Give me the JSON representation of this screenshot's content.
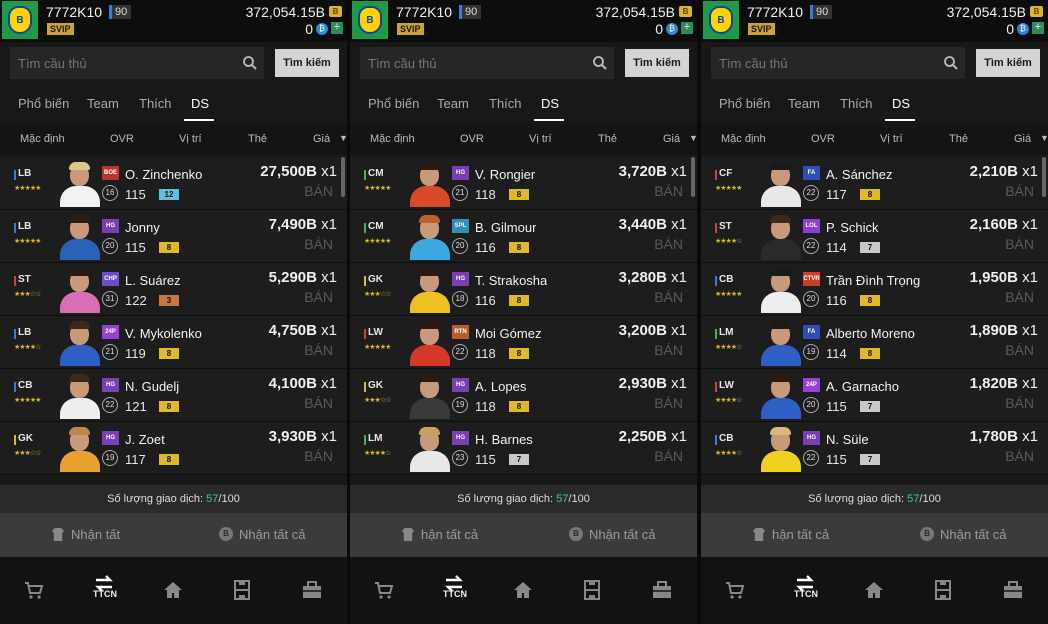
{
  "panels": [
    {
      "user": {
        "name": "7772K10",
        "level": "90",
        "svip": "SVIP",
        "coins": "372,054.15B",
        "credits": "0"
      },
      "search": {
        "placeholder": "Tìm cầu thủ",
        "button": "Tìm kiếm"
      },
      "tabs": [
        "Phổ biến",
        "Team",
        "Thích",
        "DS"
      ],
      "active_tab": "DS",
      "columns": [
        "Mặc định",
        "OVR",
        "Vị trí",
        "Thẻ",
        "Giá"
      ],
      "rows": [
        {
          "pos": "LB",
          "pos_color": "#3c7bd8",
          "stars": "★★★★★",
          "season": "BOE",
          "season_color": "#b8372c",
          "name": "O. Zinchenko",
          "ovr": "115",
          "level": "16",
          "grade": "12",
          "grade_color": "#5ec0e6",
          "price": "27,500B",
          "qty": "x1",
          "sell": "BÁN",
          "hair": "#d9c88c",
          "shirt": "#f2f2f2"
        },
        {
          "pos": "LB",
          "pos_color": "#3c7bd8",
          "stars": "★★★★★",
          "season": "HG",
          "season_color": "#7a3fb5",
          "name": "Jonny",
          "ovr": "115",
          "level": "20",
          "grade": "8",
          "grade_color": "#e0b92a",
          "price": "7,490B",
          "qty": "x1",
          "sell": "BÁN",
          "hair": "#2b1d14",
          "shirt": "#2b62b8"
        },
        {
          "pos": "ST",
          "pos_color": "#d04040",
          "stars": "★★★☆☆",
          "season": "CHP",
          "season_color": "#6a4fc9",
          "name": "L. Suárez",
          "ovr": "122",
          "level": "31",
          "grade": "3",
          "grade_color": "#c7773f",
          "price": "5,290B",
          "qty": "x1",
          "sell": "BÁN",
          "hair": "#2a1a12",
          "shirt": "#d86fb5"
        },
        {
          "pos": "LB",
          "pos_color": "#3c7bd8",
          "stars": "★★★★☆",
          "season": "24P",
          "season_color": "#9a3fd6",
          "name": "V. Mykolenko",
          "ovr": "119",
          "level": "21",
          "grade": "8",
          "grade_color": "#e0b92a",
          "price": "4,750B",
          "qty": "x1",
          "sell": "BÁN",
          "hair": "#3a2a1c",
          "shirt": "#2d5fc4"
        },
        {
          "pos": "CB",
          "pos_color": "#3c7bd8",
          "stars": "★★★★★",
          "season": "HG",
          "season_color": "#7a3fb5",
          "name": "N. Gudelj",
          "ovr": "121",
          "level": "22",
          "grade": "8",
          "grade_color": "#e0b92a",
          "price": "4,100B",
          "qty": "x1",
          "sell": "BÁN",
          "hair": "#3a2a1c",
          "shirt": "#eeeeee"
        },
        {
          "pos": "GK",
          "pos_color": "#e0b92a",
          "stars": "★★★☆☆",
          "season": "HG",
          "season_color": "#7a3fb5",
          "name": "J. Zoet",
          "ovr": "117",
          "level": "19",
          "grade": "8",
          "grade_color": "#e0b92a",
          "price": "3,930B",
          "qty": "x1",
          "sell": "BÁN",
          "hair": "#b98a4a",
          "shirt": "#e8a030"
        }
      ],
      "trades": {
        "label": "Số lượng giao dịch:",
        "count": "57",
        "total": "/100"
      },
      "actions": {
        "receive_all": "Nhận tất",
        "receive_all_coins": "Nhận tất cả"
      },
      "nav": {
        "market_label": "TTCN"
      }
    },
    {
      "user": {
        "name": "7772K10",
        "level": "90",
        "svip": "SVIP",
        "coins": "372,054.15B",
        "credits": "0"
      },
      "search": {
        "placeholder": "Tìm cầu thủ",
        "button": "Tìm kiếm"
      },
      "tabs": [
        "Phổ biến",
        "Team",
        "Thích",
        "DS"
      ],
      "active_tab": "DS",
      "columns": [
        "Mặc định",
        "OVR",
        "Vị trí",
        "Thẻ",
        "Giá"
      ],
      "rows": [
        {
          "pos": "CM",
          "pos_color": "#3fb55a",
          "stars": "★★★★★",
          "season": "HG",
          "season_color": "#7a3fb5",
          "name": "V. Rongier",
          "ovr": "118",
          "level": "21",
          "grade": "8",
          "grade_color": "#e0b92a",
          "price": "3,720B",
          "qty": "x1",
          "sell": "BÁN",
          "hair": "#2a1a12",
          "shirt": "#d84a2a"
        },
        {
          "pos": "CM",
          "pos_color": "#3fb55a",
          "stars": "★★★★★",
          "season": "SPL",
          "season_color": "#2f8fb5",
          "name": "B. Gilmour",
          "ovr": "116",
          "level": "20",
          "grade": "8",
          "grade_color": "#e0b92a",
          "price": "3,440B",
          "qty": "x1",
          "sell": "BÁN",
          "hair": "#b9622a",
          "shirt": "#3ea6e0"
        },
        {
          "pos": "GK",
          "pos_color": "#e0b92a",
          "stars": "★★★☆☆",
          "season": "HG",
          "season_color": "#7a3fb5",
          "name": "T. Strakosha",
          "ovr": "116",
          "level": "18",
          "grade": "8",
          "grade_color": "#e0b92a",
          "price": "3,280B",
          "qty": "x1",
          "sell": "BÁN",
          "hair": "#2a1a12",
          "shirt": "#f0c020"
        },
        {
          "pos": "LW",
          "pos_color": "#d04040",
          "stars": "★★★★★",
          "season": "RTN",
          "season_color": "#b8602c",
          "name": "Moi Gómez",
          "ovr": "118",
          "level": "22",
          "grade": "8",
          "grade_color": "#e0b92a",
          "price": "3,200B",
          "qty": "x1",
          "sell": "BÁN",
          "hair": "#2a1a12",
          "shirt": "#d8382a"
        },
        {
          "pos": "GK",
          "pos_color": "#e0b92a",
          "stars": "★★★☆☆",
          "season": "HG",
          "season_color": "#7a3fb5",
          "name": "A. Lopes",
          "ovr": "118",
          "level": "19",
          "grade": "8",
          "grade_color": "#e0b92a",
          "price": "2,930B",
          "qty": "x1",
          "sell": "BÁN",
          "hair": "#2a1a12",
          "shirt": "#3a3a3a"
        },
        {
          "pos": "LM",
          "pos_color": "#3fb55a",
          "stars": "★★★★☆",
          "season": "HG",
          "season_color": "#7a3fb5",
          "name": "H. Barnes",
          "ovr": "115",
          "level": "23",
          "grade": "7",
          "grade_color": "#c8c8c8",
          "price": "2,250B",
          "qty": "x1",
          "sell": "BÁN",
          "hair": "#c9a060",
          "shirt": "#e8e8e8"
        }
      ],
      "trades": {
        "label": "Số lượng giao dịch:",
        "count": "57",
        "total": "/100"
      },
      "actions": {
        "receive_all": "hận tất cả",
        "receive_all_coins": "Nhận tất cả"
      },
      "nav": {
        "market_label": "TTCN"
      }
    },
    {
      "user": {
        "name": "7772K10",
        "level": "90",
        "svip": "SVIP",
        "coins": "372,054.15B",
        "credits": "0"
      },
      "search": {
        "placeholder": "Tìm cầu thủ",
        "button": "Tìm kiếm"
      },
      "tabs": [
        "Phổ biến",
        "Team",
        "Thích",
        "DS"
      ],
      "active_tab": "DS",
      "columns": [
        "Mặc định",
        "OVR",
        "Vị trí",
        "Thẻ",
        "Giá"
      ],
      "rows": [
        {
          "pos": "CF",
          "pos_color": "#d04040",
          "stars": "★★★★★",
          "season": "FA",
          "season_color": "#2f4fb5",
          "name": "A. Sánchez",
          "ovr": "117",
          "level": "22",
          "grade": "8",
          "grade_color": "#e0b92a",
          "price": "2,210B",
          "qty": "x1",
          "sell": "BÁN",
          "hair": "#1a1a1a",
          "shirt": "#e8e8e8"
        },
        {
          "pos": "ST",
          "pos_color": "#d04040",
          "stars": "★★★★☆",
          "season": "LOL",
          "season_color": "#8f3fd6",
          "name": "P. Schick",
          "ovr": "114",
          "level": "22",
          "grade": "7",
          "grade_color": "#c8c8c8",
          "price": "2,160B",
          "qty": "x1",
          "sell": "BÁN",
          "hair": "#3a2a1c",
          "shirt": "#2a2a2a"
        },
        {
          "pos": "CB",
          "pos_color": "#3c7bd8",
          "stars": "★★★★★",
          "season": "CTVR",
          "season_color": "#c8402a",
          "name": "Trần Đình Trọng",
          "ovr": "116",
          "level": "20",
          "grade": "8",
          "grade_color": "#e0b92a",
          "price": "1,950B",
          "qty": "x1",
          "sell": "BÁN",
          "hair": "#1a1a1a",
          "shirt": "#eeeeee"
        },
        {
          "pos": "LM",
          "pos_color": "#3fb55a",
          "stars": "★★★★☆",
          "season": "FA",
          "season_color": "#2f4fb5",
          "name": "Alberto Moreno",
          "ovr": "114",
          "level": "19",
          "grade": "8",
          "grade_color": "#e0b92a",
          "price": "1,890B",
          "qty": "x1",
          "sell": "BÁN",
          "hair": "#1a1a1a",
          "shirt": "#2d5fc4"
        },
        {
          "pos": "LW",
          "pos_color": "#d04040",
          "stars": "★★★★☆",
          "season": "24P",
          "season_color": "#9a3fd6",
          "name": "A. Garnacho",
          "ovr": "115",
          "level": "20",
          "grade": "7",
          "grade_color": "#c8c8c8",
          "price": "1,820B",
          "qty": "x1",
          "sell": "BÁN",
          "hair": "#2a1a12",
          "shirt": "#2d5fc4"
        },
        {
          "pos": "CB",
          "pos_color": "#3c7bd8",
          "stars": "★★★★☆",
          "season": "HG",
          "season_color": "#7a3fb5",
          "name": "N. Süle",
          "ovr": "115",
          "level": "22",
          "grade": "7",
          "grade_color": "#c8c8c8",
          "price": "1,780B",
          "qty": "x1",
          "sell": "BÁN",
          "hair": "#d9b87a",
          "shirt": "#f0d020"
        }
      ],
      "trades": {
        "label": "Số lượng giao dịch:",
        "count": "57",
        "total": "/100"
      },
      "actions": {
        "receive_all": "hận tất cả",
        "receive_all_coins": "Nhận tất cả"
      },
      "nav": {
        "market_label": "TTCN"
      }
    }
  ]
}
